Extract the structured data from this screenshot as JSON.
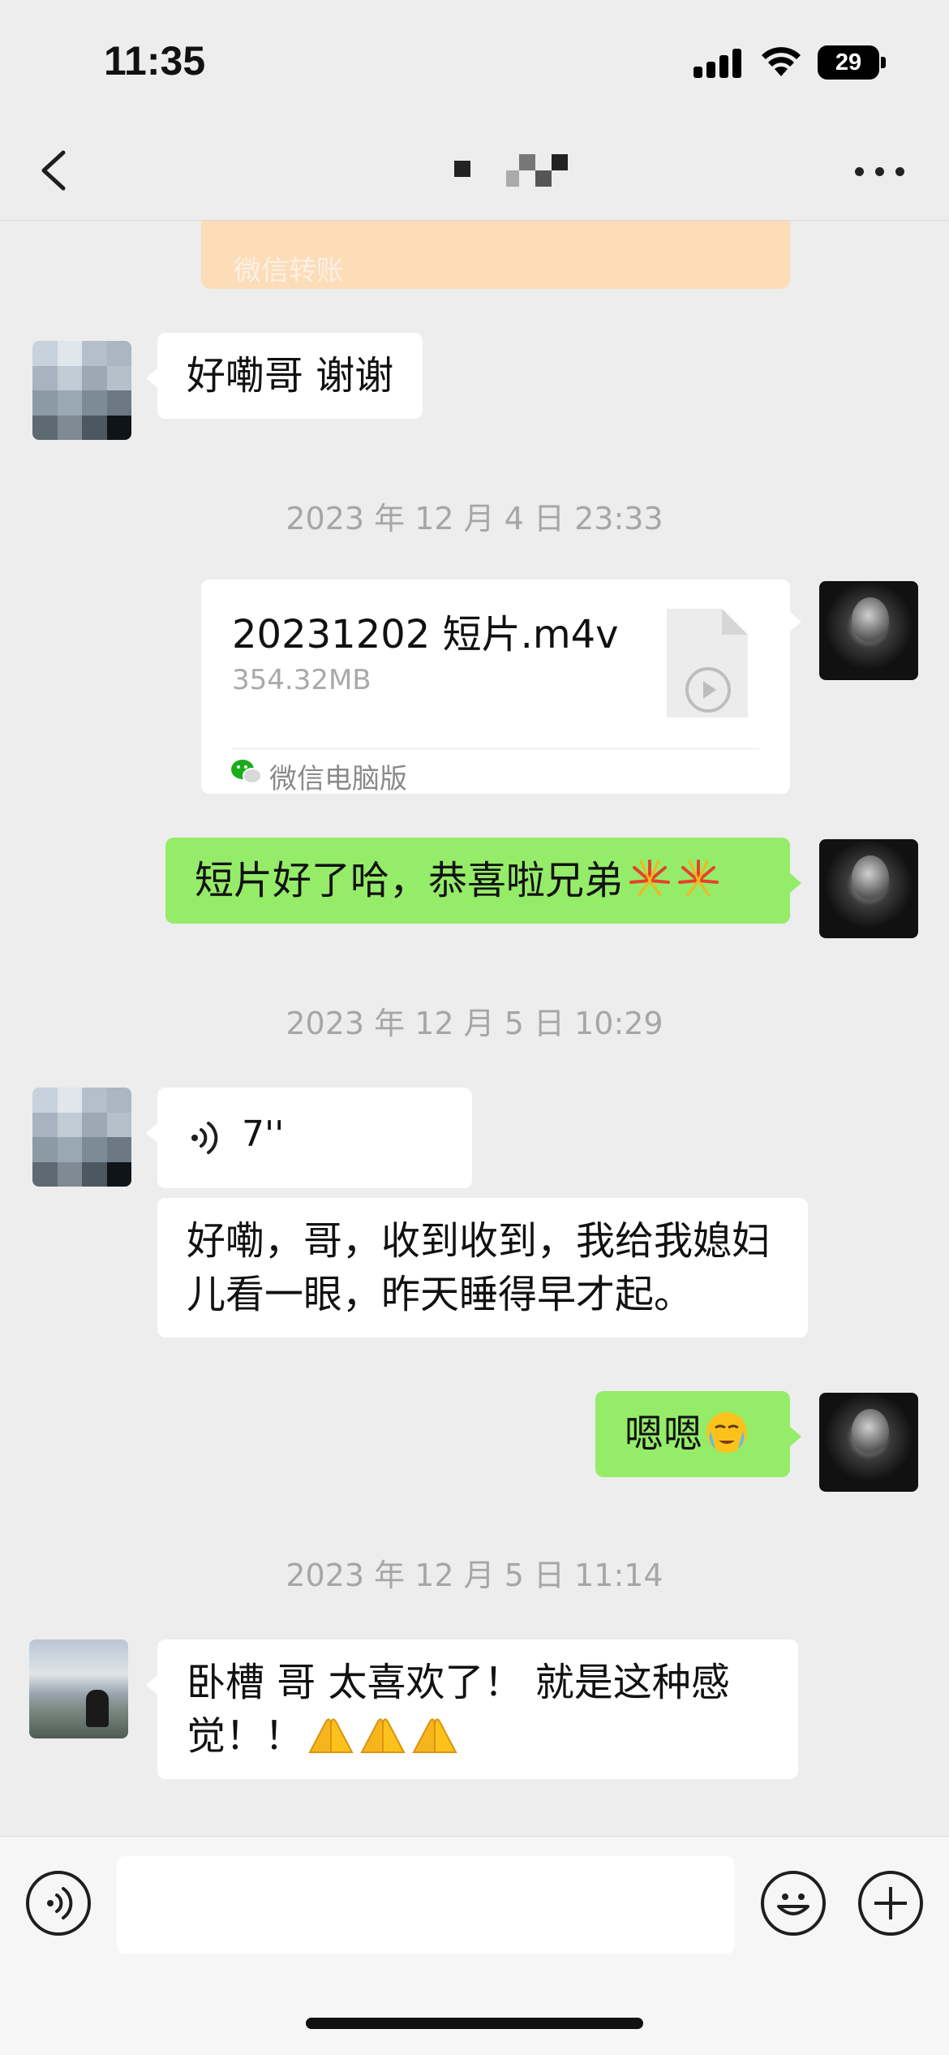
{
  "status_bar": {
    "time": "11:35",
    "battery": "29"
  },
  "nav": {
    "back_icon": "chevron-left-icon",
    "title_note": "",
    "more_icon": "ellipsis-icon"
  },
  "messages": {
    "transfer_label": "微信转账",
    "msg1_text": "好嘞哥 谢谢",
    "ts1": "2023 年 12 月 4 日 23:33",
    "file_name": "20231202 短片.m4v",
    "file_size": "354.32MB",
    "file_source": "微信电脑版",
    "msg2_text": "短片好了哈，恭喜啦兄弟",
    "ts2": "2023 年 12 月 5 日 10:29",
    "voice_duration": "7''",
    "msg3_text": "好嘞，哥，收到收到，我给我媳妇儿看一眼，昨天睡得早才起。",
    "msg4_text": "嗯嗯",
    "ts3": "2023 年 12 月 5 日 11:14",
    "msg5_text": "卧槽 哥 太喜欢了！ 就是这种感觉！！"
  },
  "input": {
    "placeholder": ""
  },
  "colors": {
    "sent_bubble": "#95ec69",
    "received_bubble": "#ffffff",
    "background": "#ededed",
    "transfer_card": "#fddcb8"
  }
}
